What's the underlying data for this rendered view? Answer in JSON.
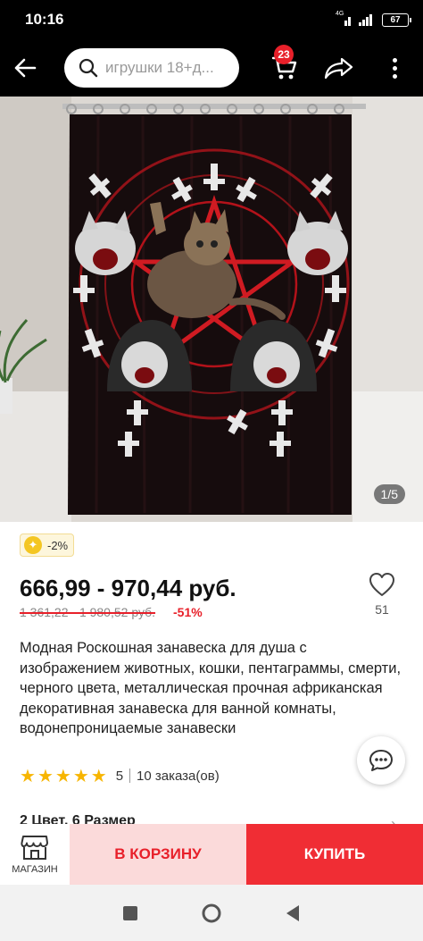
{
  "status_bar": {
    "time": "10:16",
    "network": "4G",
    "battery": "67"
  },
  "toolbar": {
    "search_placeholder": "игрушки 18+д...",
    "cart_count": "23"
  },
  "gallery": {
    "counter": "1/5"
  },
  "product": {
    "discount_badge": "-2%",
    "price": "666,99 - 970,44 руб.",
    "old_price": "1 361,22 - 1 980,52 руб.",
    "discount_percent": "-51%",
    "wishlist_count": "51",
    "title": "Модная Роскошная занавеска для душа с изображением животных, кошки, пентаграммы, смерти, черного цвета, металлическая прочная африканская декоративная занавеска для ванной комнаты, водонепроницаемые занавески",
    "rating": "5",
    "orders": "10 заказа(ов)",
    "variants": "2 Цвет, 6 Размер"
  },
  "action_bar": {
    "store_label": "МАГАЗИН",
    "add_to_cart": "В КОРЗИНУ",
    "buy_now": "КУПИТЬ"
  },
  "colors": {
    "accent": "#f02d34",
    "accent_light": "#fbdada",
    "star": "#f7b500",
    "curtain_red": "#b3121a"
  }
}
